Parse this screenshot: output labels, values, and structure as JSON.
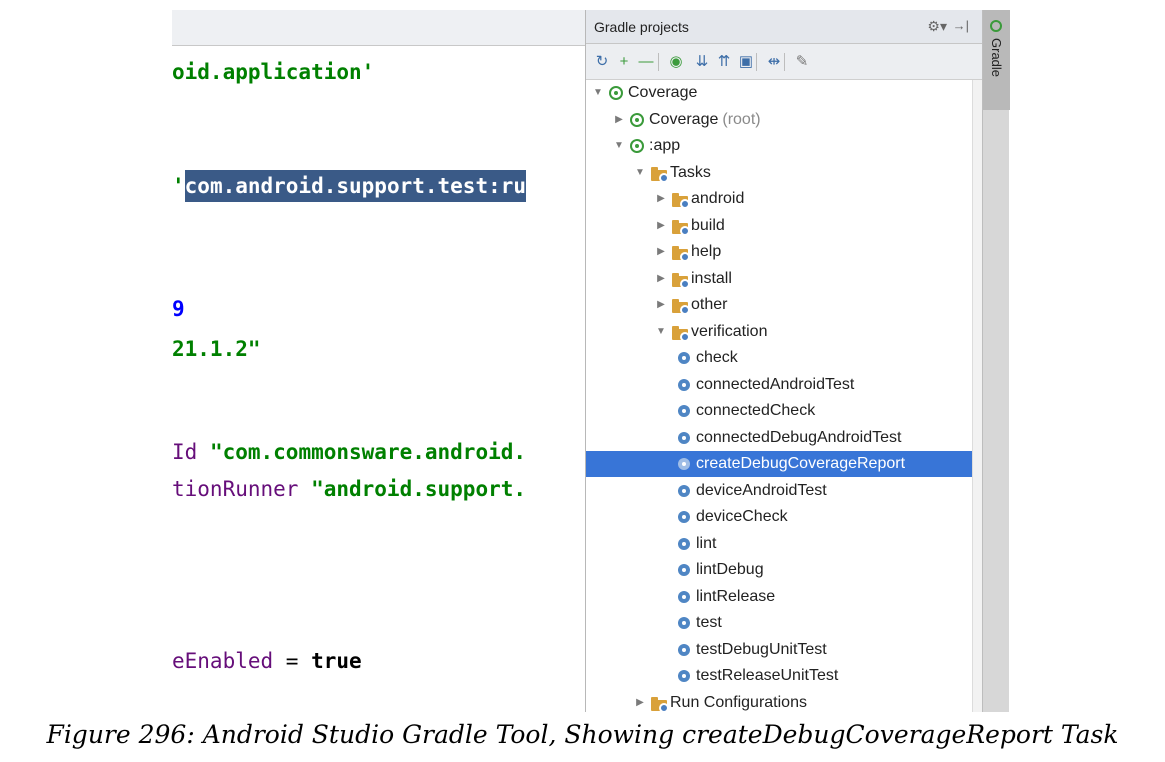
{
  "editor": {
    "lines": [
      {
        "id": "l1",
        "segments": [
          {
            "text": "oid.application'",
            "cls": "c-green"
          }
        ]
      },
      {
        "id": "l2",
        "segments": [
          {
            "text": "'",
            "cls": "c-green"
          },
          {
            "text": "com.android.support.test:ru",
            "cls": "c-selected"
          }
        ]
      },
      {
        "id": "l3",
        "segments": [
          {
            "text": "9",
            "cls": "c-blue"
          }
        ]
      },
      {
        "id": "l4",
        "segments": [
          {
            "text": "21.1.2\"",
            "cls": "c-green"
          }
        ]
      },
      {
        "id": "l5",
        "segments": [
          {
            "text": "Id ",
            "cls": "c-purple plain"
          },
          {
            "text": "\"com.commonsware.android.",
            "cls": "c-green"
          }
        ]
      },
      {
        "id": "l6",
        "segments": [
          {
            "text": "tionRunner ",
            "cls": "c-purple plain"
          },
          {
            "text": "\"android.support.",
            "cls": "c-green"
          }
        ]
      },
      {
        "id": "l7",
        "segments": [
          {
            "text": "eEnabled ",
            "cls": "c-purple plain"
          },
          {
            "text": "= ",
            "cls": "c-black plain"
          },
          {
            "text": "true",
            "cls": "c-black"
          }
        ]
      }
    ]
  },
  "gradle_panel": {
    "title": "Gradle projects",
    "settings_icon": "⚙▾",
    "hide_icon": "→|",
    "toolbar": [
      {
        "name": "refresh-icon",
        "glyph": "↻"
      },
      {
        "name": "add-icon",
        "glyph": "+"
      },
      {
        "name": "remove-icon",
        "glyph": "—"
      },
      {
        "name": "execute-task-icon",
        "glyph": "◉"
      },
      {
        "name": "expand-all-icon",
        "glyph": "⇊"
      },
      {
        "name": "collapse-all-icon",
        "glyph": "⇈"
      },
      {
        "name": "group-tasks-icon",
        "glyph": "▣"
      },
      {
        "name": "toggle-offline-icon",
        "glyph": "⇹"
      },
      {
        "name": "gradle-settings-icon",
        "glyph": "✎"
      }
    ],
    "tree": [
      {
        "label": "Coverage",
        "suffix": "",
        "icon": "gradle",
        "arrow": "▼",
        "level": 0
      },
      {
        "label": "Coverage",
        "suffix": "(root)",
        "icon": "gradle",
        "arrow": "▶",
        "level": 1
      },
      {
        "label": ":app",
        "suffix": "",
        "icon": "gradle",
        "arrow": "▼",
        "level": 1
      },
      {
        "label": "Tasks",
        "suffix": "",
        "icon": "folder",
        "arrow": "▼",
        "level": 2
      },
      {
        "label": "android",
        "suffix": "",
        "icon": "folder",
        "arrow": "▶",
        "level": 3
      },
      {
        "label": "build",
        "suffix": "",
        "icon": "folder",
        "arrow": "▶",
        "level": 3
      },
      {
        "label": "help",
        "suffix": "",
        "icon": "folder",
        "arrow": "▶",
        "level": 3
      },
      {
        "label": "install",
        "suffix": "",
        "icon": "folder",
        "arrow": "▶",
        "level": 3
      },
      {
        "label": "other",
        "suffix": "",
        "icon": "folder",
        "arrow": "▶",
        "level": 3
      },
      {
        "label": "verification",
        "suffix": "",
        "icon": "folder",
        "arrow": "▼",
        "level": 3
      },
      {
        "label": "check",
        "suffix": "",
        "icon": "task",
        "arrow": "",
        "level": 4
      },
      {
        "label": "connectedAndroidTest",
        "suffix": "",
        "icon": "task",
        "arrow": "",
        "level": 4
      },
      {
        "label": "connectedCheck",
        "suffix": "",
        "icon": "task",
        "arrow": "",
        "level": 4
      },
      {
        "label": "connectedDebugAndroidTest",
        "suffix": "",
        "icon": "task",
        "arrow": "",
        "level": 4
      },
      {
        "label": "createDebugCoverageReport",
        "suffix": "",
        "icon": "task",
        "arrow": "",
        "level": 4,
        "selected": true
      },
      {
        "label": "deviceAndroidTest",
        "suffix": "",
        "icon": "task",
        "arrow": "",
        "level": 4
      },
      {
        "label": "deviceCheck",
        "suffix": "",
        "icon": "task",
        "arrow": "",
        "level": 4
      },
      {
        "label": "lint",
        "suffix": "",
        "icon": "task",
        "arrow": "",
        "level": 4
      },
      {
        "label": "lintDebug",
        "suffix": "",
        "icon": "task",
        "arrow": "",
        "level": 4
      },
      {
        "label": "lintRelease",
        "suffix": "",
        "icon": "task",
        "arrow": "",
        "level": 4
      },
      {
        "label": "test",
        "suffix": "",
        "icon": "task",
        "arrow": "",
        "level": 4
      },
      {
        "label": "testDebugUnitTest",
        "suffix": "",
        "icon": "task",
        "arrow": "",
        "level": 4
      },
      {
        "label": "testReleaseUnitTest",
        "suffix": "",
        "icon": "task",
        "arrow": "",
        "level": 4
      },
      {
        "label": "Run Configurations",
        "suffix": "",
        "icon": "folder",
        "arrow": "▶",
        "level": 2
      }
    ]
  },
  "side_strip": {
    "tab_label": "Gradle"
  },
  "caption": "Figure 296: Android Studio Gradle Tool, Showing createDebugCoverageReport Task",
  "colors": {
    "selection": "#3875d7",
    "editor_selection": "#3a5a87",
    "string_green": "#008000",
    "number_blue": "#0000ff",
    "keyword_purple": "#660e7a"
  }
}
